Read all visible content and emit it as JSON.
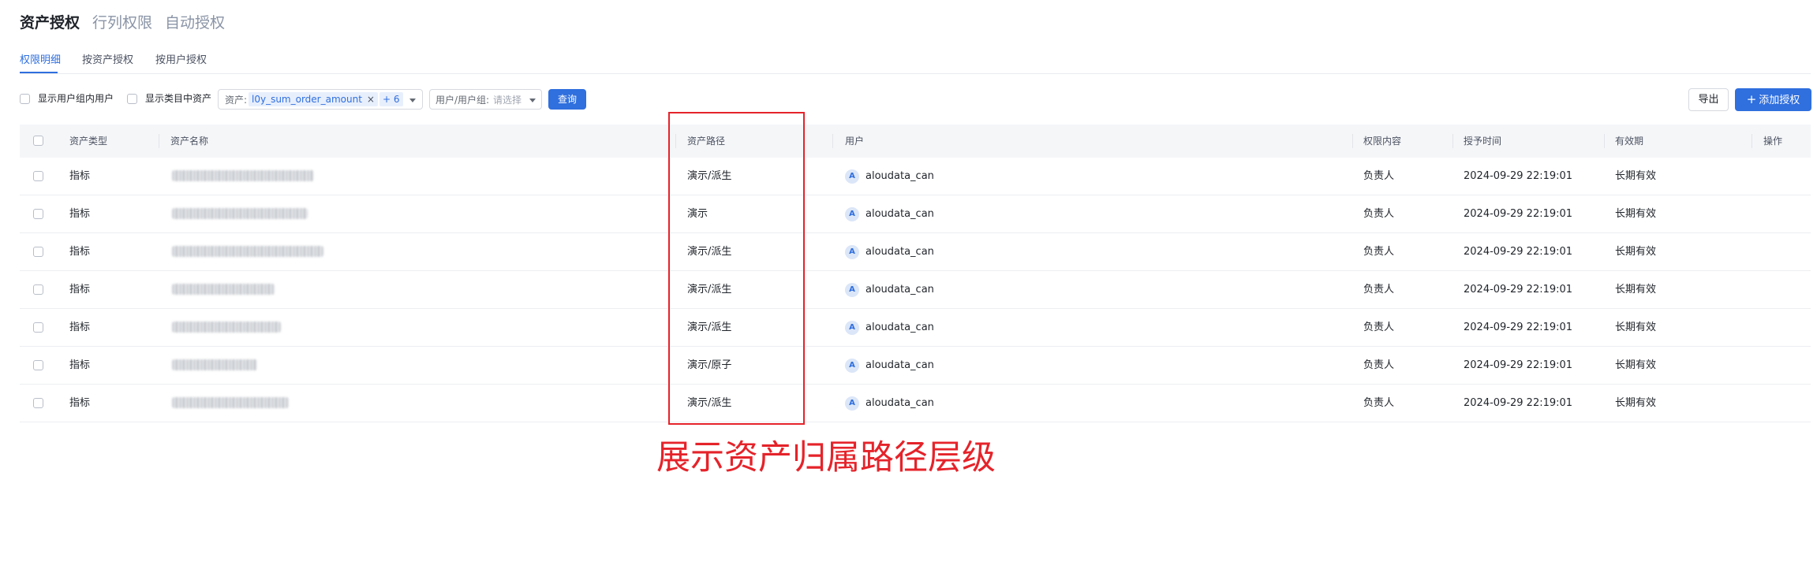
{
  "top_tabs": [
    {
      "label": "资产授权",
      "active": true
    },
    {
      "label": "行列权限",
      "active": false
    },
    {
      "label": "自动授权",
      "active": false
    }
  ],
  "sub_tabs": [
    {
      "label": "权限明细",
      "active": true
    },
    {
      "label": "按资产授权",
      "active": false
    },
    {
      "label": "按用户授权",
      "active": false
    }
  ],
  "filters": {
    "show_group_users": "显示用户组内用户",
    "show_category_assets": "显示类目中资产",
    "asset_prefix": "资产:",
    "asset_tag": "l0y_sum_order_amount",
    "asset_more": "+ 6",
    "user_prefix": "用户/用户组:",
    "user_placeholder": "请选择",
    "query_button": "查询"
  },
  "actions": {
    "export_button": "导出",
    "add_button": "添加授权",
    "add_icon": "plus-icon"
  },
  "table": {
    "columns": [
      "资产类型",
      "资产名称",
      "资产路径",
      "用户",
      "权限内容",
      "授予时间",
      "有效期",
      "操作"
    ],
    "rows": [
      {
        "type": "指标",
        "path": "演示/派生",
        "user": "aloudata_can",
        "avatar": "A",
        "permission": "负责人",
        "granted": "2024-09-29 22:19:01",
        "validity": "长期有效"
      },
      {
        "type": "指标",
        "path": "演示",
        "user": "aloudata_can",
        "avatar": "A",
        "permission": "负责人",
        "granted": "2024-09-29 22:19:01",
        "validity": "长期有效"
      },
      {
        "type": "指标",
        "path": "演示/派生",
        "user": "aloudata_can",
        "avatar": "A",
        "permission": "负责人",
        "granted": "2024-09-29 22:19:01",
        "validity": "长期有效"
      },
      {
        "type": "指标",
        "path": "演示/派生",
        "user": "aloudata_can",
        "avatar": "A",
        "permission": "负责人",
        "granted": "2024-09-29 22:19:01",
        "validity": "长期有效"
      },
      {
        "type": "指标",
        "path": "演示/派生",
        "user": "aloudata_can",
        "avatar": "A",
        "permission": "负责人",
        "granted": "2024-09-29 22:19:01",
        "validity": "长期有效"
      },
      {
        "type": "指标",
        "path": "演示/原子",
        "user": "aloudata_can",
        "avatar": "A",
        "permission": "负责人",
        "granted": "2024-09-29 22:19:01",
        "validity": "长期有效"
      },
      {
        "type": "指标",
        "path": "演示/派生",
        "user": "aloudata_can",
        "avatar": "A",
        "permission": "负责人",
        "granted": "2024-09-29 22:19:01",
        "validity": "长期有效"
      }
    ]
  },
  "annotation": {
    "text": "展示资产归属路径层级",
    "color": "#e5232a"
  },
  "colors": {
    "accent": "#2f6fde",
    "header_bg": "#f5f6f8"
  }
}
